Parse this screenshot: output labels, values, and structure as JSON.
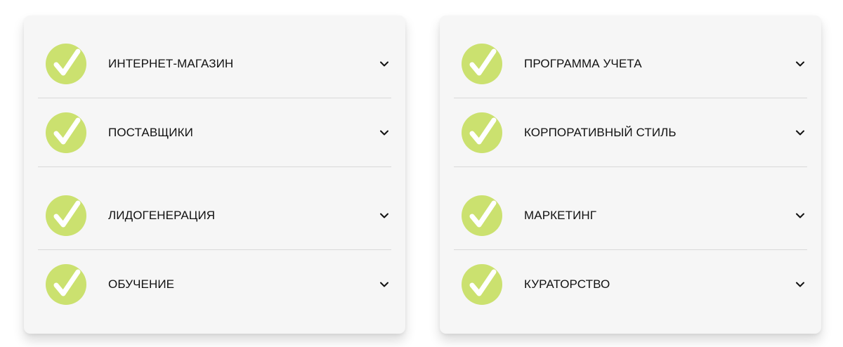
{
  "colors": {
    "check_circle": "#cbe16f",
    "check_mark": "#ffffff",
    "panel_bg": "#f6f6f6",
    "text": "#111111"
  },
  "left_panel": {
    "items": [
      {
        "label": "ИНТЕРНЕТ-МАГАЗИН",
        "icon": "check-circle-icon",
        "expand_icon": "chevron-down-icon"
      },
      {
        "label": "ПОСТАВЩИКИ",
        "icon": "check-circle-icon",
        "expand_icon": "chevron-down-icon"
      },
      {
        "label": "ЛИДОГЕНЕРАЦИЯ",
        "icon": "check-circle-icon",
        "expand_icon": "chevron-down-icon"
      },
      {
        "label": "ОБУЧЕНИЕ",
        "icon": "check-circle-icon",
        "expand_icon": "chevron-down-icon"
      }
    ]
  },
  "right_panel": {
    "items": [
      {
        "label": "ПРОГРАММА УЧЕТА",
        "icon": "check-circle-icon",
        "expand_icon": "chevron-down-icon"
      },
      {
        "label": "КОРПОРАТИВНЫЙ СТИЛЬ",
        "icon": "check-circle-icon",
        "expand_icon": "chevron-down-icon"
      },
      {
        "label": "МАРКЕТИНГ",
        "icon": "check-circle-icon",
        "expand_icon": "chevron-down-icon"
      },
      {
        "label": "КУРАТОРСТВО",
        "icon": "check-circle-icon",
        "expand_icon": "chevron-down-icon"
      }
    ]
  }
}
